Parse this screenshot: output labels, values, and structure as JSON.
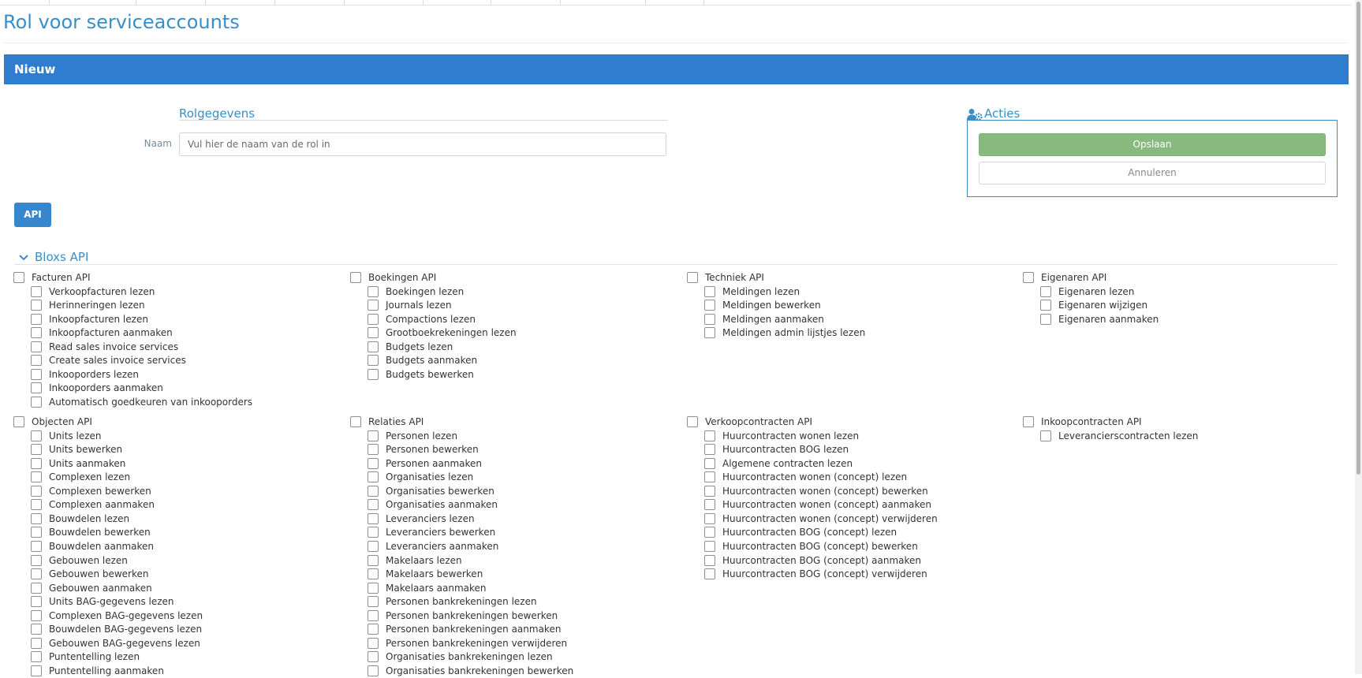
{
  "page_title": "Rol voor serviceaccounts",
  "panel_header": "Nieuw",
  "rolgegevens": {
    "heading": "Rolgegevens",
    "name_label": "Naam",
    "name_placeholder": "Vul hier de naam van de rol in",
    "name_value": ""
  },
  "acties": {
    "heading": "Acties",
    "save_label": "Opslaan",
    "cancel_label": "Annuleren"
  },
  "api_button": "API",
  "bloxs_api": {
    "heading": "Bloxs API",
    "groups": [
      {
        "label": "Facturen API",
        "checked": false,
        "items": [
          {
            "label": "Verkoopfacturen lezen",
            "checked": false
          },
          {
            "label": "Herinneringen lezen",
            "checked": false
          },
          {
            "label": "Inkoopfacturen lezen",
            "checked": false
          },
          {
            "label": "Inkoopfacturen aanmaken",
            "checked": false
          },
          {
            "label": "Read sales invoice services",
            "checked": false
          },
          {
            "label": "Create sales invoice services",
            "checked": false
          },
          {
            "label": "Inkooporders lezen",
            "checked": false
          },
          {
            "label": "Inkooporders aanmaken",
            "checked": false
          },
          {
            "label": "Automatisch goedkeuren van inkooporders",
            "checked": false
          }
        ]
      },
      {
        "label": "Boekingen API",
        "checked": false,
        "items": [
          {
            "label": "Boekingen lezen",
            "checked": false
          },
          {
            "label": "Journals lezen",
            "checked": false
          },
          {
            "label": "Compactions lezen",
            "checked": false
          },
          {
            "label": "Grootboekrekeningen lezen",
            "checked": false
          },
          {
            "label": "Budgets lezen",
            "checked": false
          },
          {
            "label": "Budgets aanmaken",
            "checked": false
          },
          {
            "label": "Budgets bewerken",
            "checked": false
          }
        ]
      },
      {
        "label": "Techniek API",
        "checked": false,
        "items": [
          {
            "label": "Meldingen lezen",
            "checked": false
          },
          {
            "label": "Meldingen bewerken",
            "checked": false
          },
          {
            "label": "Meldingen aanmaken",
            "checked": false
          },
          {
            "label": "Meldingen admin lijstjes lezen",
            "checked": false
          }
        ]
      },
      {
        "label": "Eigenaren API",
        "checked": false,
        "items": [
          {
            "label": "Eigenaren lezen",
            "checked": false
          },
          {
            "label": "Eigenaren wijzigen",
            "checked": false
          },
          {
            "label": "Eigenaren aanmaken",
            "checked": false
          }
        ]
      },
      {
        "label": "Objecten API",
        "checked": false,
        "items": [
          {
            "label": "Units lezen",
            "checked": false
          },
          {
            "label": "Units bewerken",
            "checked": false
          },
          {
            "label": "Units aanmaken",
            "checked": false
          },
          {
            "label": "Complexen lezen",
            "checked": false
          },
          {
            "label": "Complexen bewerken",
            "checked": false
          },
          {
            "label": "Complexen aanmaken",
            "checked": false
          },
          {
            "label": "Bouwdelen lezen",
            "checked": false
          },
          {
            "label": "Bouwdelen bewerken",
            "checked": false
          },
          {
            "label": "Bouwdelen aanmaken",
            "checked": false
          },
          {
            "label": "Gebouwen lezen",
            "checked": false
          },
          {
            "label": "Gebouwen bewerken",
            "checked": false
          },
          {
            "label": "Gebouwen aanmaken",
            "checked": false
          },
          {
            "label": "Units BAG-gegevens lezen",
            "checked": false
          },
          {
            "label": "Complexen BAG-gegevens lezen",
            "checked": false
          },
          {
            "label": "Bouwdelen BAG-gegevens lezen",
            "checked": false
          },
          {
            "label": "Gebouwen BAG-gegevens lezen",
            "checked": false
          },
          {
            "label": "Puntentelling lezen",
            "checked": false
          },
          {
            "label": "Puntentelling aanmaken",
            "checked": false
          }
        ]
      },
      {
        "label": "Relaties API",
        "checked": false,
        "items": [
          {
            "label": "Personen lezen",
            "checked": false
          },
          {
            "label": "Personen bewerken",
            "checked": false
          },
          {
            "label": "Personen aanmaken",
            "checked": false
          },
          {
            "label": "Organisaties lezen",
            "checked": false
          },
          {
            "label": "Organisaties bewerken",
            "checked": false
          },
          {
            "label": "Organisaties aanmaken",
            "checked": false
          },
          {
            "label": "Leveranciers lezen",
            "checked": false
          },
          {
            "label": "Leveranciers bewerken",
            "checked": false
          },
          {
            "label": "Leveranciers aanmaken",
            "checked": false
          },
          {
            "label": "Makelaars lezen",
            "checked": false
          },
          {
            "label": "Makelaars bewerken",
            "checked": false
          },
          {
            "label": "Makelaars aanmaken",
            "checked": false
          },
          {
            "label": "Personen bankrekeningen lezen",
            "checked": false
          },
          {
            "label": "Personen bankrekeningen bewerken",
            "checked": false
          },
          {
            "label": "Personen bankrekeningen aanmaken",
            "checked": false
          },
          {
            "label": "Personen bankrekeningen verwijderen",
            "checked": false
          },
          {
            "label": "Organisaties bankrekeningen lezen",
            "checked": false
          },
          {
            "label": "Organisaties bankrekeningen bewerken",
            "checked": false
          }
        ]
      },
      {
        "label": "Verkoopcontracten API",
        "checked": false,
        "items": [
          {
            "label": "Huurcontracten wonen lezen",
            "checked": false
          },
          {
            "label": "Huurcontracten BOG lezen",
            "checked": false
          },
          {
            "label": "Algemene contracten lezen",
            "checked": false
          },
          {
            "label": "Huurcontracten wonen (concept) lezen",
            "checked": false
          },
          {
            "label": "Huurcontracten wonen (concept) bewerken",
            "checked": false
          },
          {
            "label": "Huurcontracten wonen (concept) aanmaken",
            "checked": false
          },
          {
            "label": "Huurcontracten wonen (concept) verwijderen",
            "checked": false
          },
          {
            "label": "Huurcontracten BOG (concept) lezen",
            "checked": false
          },
          {
            "label": "Huurcontracten BOG (concept) bewerken",
            "checked": false
          },
          {
            "label": "Huurcontracten BOG (concept) aanmaken",
            "checked": false
          },
          {
            "label": "Huurcontracten BOG (concept) verwijderen",
            "checked": false
          }
        ]
      },
      {
        "label": "Inkoopcontracten API",
        "checked": false,
        "items": [
          {
            "label": "Leverancierscontracten lezen",
            "checked": false
          }
        ]
      }
    ]
  }
}
